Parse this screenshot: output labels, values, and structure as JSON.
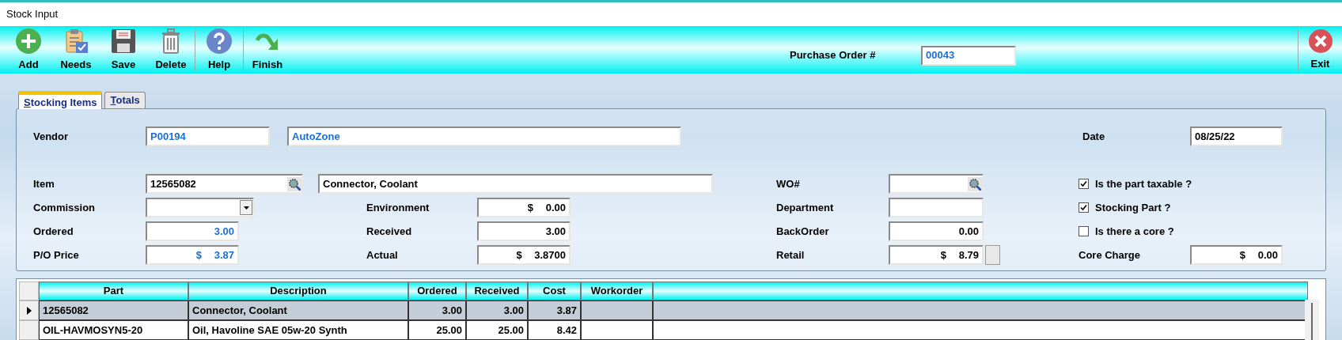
{
  "window": {
    "title": "Stock Input"
  },
  "toolbar": [
    {
      "label": "Add",
      "kind": "add"
    },
    {
      "label": "Needs",
      "kind": "needs"
    },
    {
      "label": "Save",
      "kind": "save"
    },
    {
      "label": "Delete",
      "kind": "delete",
      "separator_after": true
    },
    {
      "label": "Help",
      "kind": "help",
      "separator_after": true
    },
    {
      "label": "Finish",
      "kind": "finish"
    }
  ],
  "purchase_order": {
    "label": "Purchase Order #",
    "value": "00043"
  },
  "exit": {
    "label": "Exit"
  },
  "tabs": [
    {
      "label": "Stocking Items",
      "selected": true
    },
    {
      "label": "Totals",
      "selected": false
    }
  ],
  "vendor": {
    "label": "Vendor",
    "code": "P00194",
    "name": "AutoZone"
  },
  "date": {
    "label": "Date",
    "value": "08/25/22"
  },
  "item": {
    "label": "Item",
    "value": "12565082",
    "description": "Connector, Coolant"
  },
  "left_fields": [
    {
      "label": "Commission",
      "kind": "dropdown"
    },
    {
      "label": "Ordered",
      "kind": "number",
      "value": "3.00",
      "emphasis": true
    },
    {
      "label": "P/O Price",
      "kind": "number",
      "value": "$ 3.87",
      "emphasis": true
    }
  ],
  "middle_fields": [
    {
      "label": "Environment",
      "value": "$ 0.00"
    },
    {
      "label": "Received",
      "value": "3.00"
    },
    {
      "label": "Actual",
      "value": "$ 3.8700"
    }
  ],
  "wo": {
    "label": "WO#"
  },
  "right_fields": [
    {
      "label": "Department",
      "kind": "text"
    },
    {
      "label": "BackOrder",
      "kind": "number",
      "value": "0.00"
    },
    {
      "label": "Retail",
      "kind": "number_button",
      "value": "$ 8.79"
    }
  ],
  "checkboxes": [
    {
      "label": "Is the part taxable ?",
      "checked": true
    },
    {
      "label": "Stocking Part ?",
      "checked": true
    },
    {
      "label": "Is there a core ?",
      "checked": false
    }
  ],
  "core_charge": {
    "label": "Core Charge",
    "value": "$ 0.00"
  },
  "grid": {
    "columns": [
      "Part",
      "Description",
      "Ordered",
      "Received",
      "Cost",
      "Workorder"
    ],
    "rows": [
      {
        "selected": true,
        "cells": [
          "12565082",
          "Connector, Coolant",
          "3.00",
          "3.00",
          "3.87",
          ""
        ]
      },
      {
        "selected": false,
        "cells": [
          "OIL-HAVMOSYN5-20",
          "Oil, Havoline SAE 05w-20 Synth",
          "25.00",
          "25.00",
          "8.42",
          ""
        ]
      }
    ]
  }
}
